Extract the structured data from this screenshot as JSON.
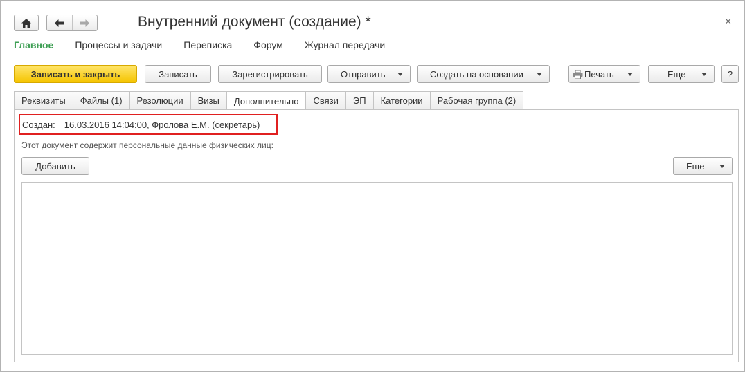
{
  "window": {
    "title": "Внутренний документ (создание) *",
    "close_glyph": "×"
  },
  "nav": {
    "home_icon": "home-icon",
    "back_icon": "arrow-left-icon",
    "forward_icon": "arrow-right-icon"
  },
  "sections": [
    {
      "label": "Главное",
      "active": true
    },
    {
      "label": "Процессы и задачи"
    },
    {
      "label": "Переписка"
    },
    {
      "label": "Форум"
    },
    {
      "label": "Журнал передачи"
    }
  ],
  "toolbar": {
    "save_close": "Записать и закрыть",
    "save": "Записать",
    "register": "Зарегистрировать",
    "send": "Отправить",
    "create_based": "Создать на основании",
    "print": "Печать",
    "more": "Еще",
    "help": "?"
  },
  "tabs": [
    {
      "label": "Реквизиты"
    },
    {
      "label": "Файлы (1)"
    },
    {
      "label": "Резолюции"
    },
    {
      "label": "Визы"
    },
    {
      "label": "Дополнительно",
      "active": true
    },
    {
      "label": "Связи"
    },
    {
      "label": "ЭП"
    },
    {
      "label": "Категории"
    },
    {
      "label": "Рабочая группа (2)"
    }
  ],
  "content": {
    "created_label": "Создан:",
    "created_value": "16.03.2016 14:04:00, Фролова Е.М. (секретарь)",
    "pd_note": "Этот документ содержит персональные данные физических лиц:",
    "add_button": "Добавить",
    "more_button": "Еще"
  },
  "colors": {
    "accent_green": "#3e9f54",
    "primary_button": "#f5c400",
    "highlight_border": "#e02020"
  }
}
